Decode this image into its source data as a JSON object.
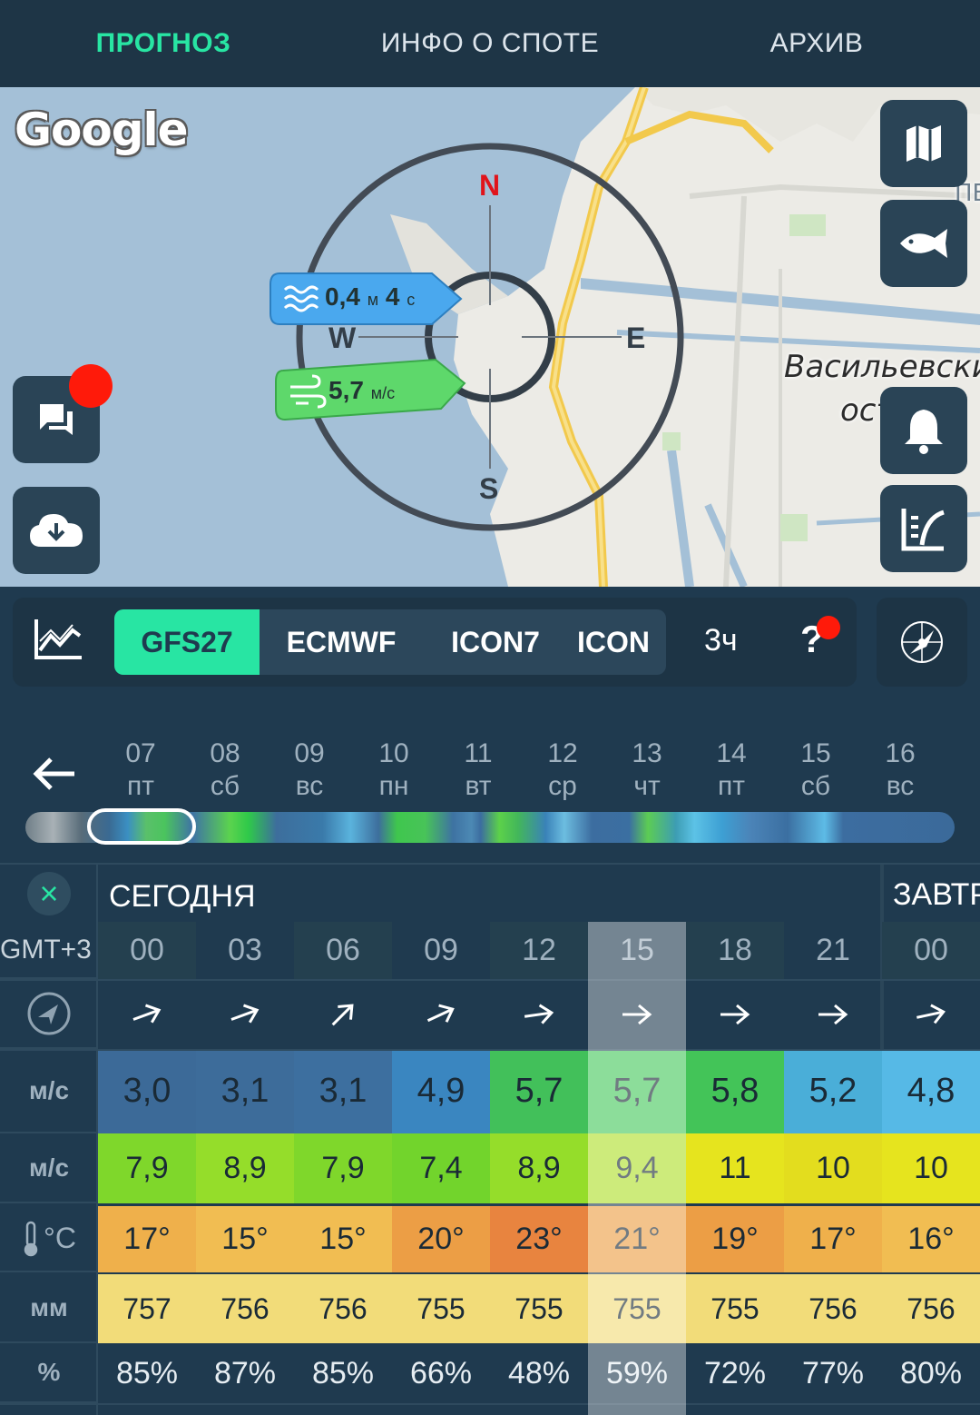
{
  "tabs": [
    {
      "label": "ПРОГНОЗ",
      "active": true
    },
    {
      "label": "ИНФО О СПОТЕ",
      "active": false
    },
    {
      "label": "АРХИВ",
      "active": false
    }
  ],
  "map": {
    "logo": "Google",
    "place_label_1": "Васильевски",
    "place_label_2": "остров",
    "edge_label": "ПЕ",
    "compass": {
      "n": "N",
      "e": "E",
      "s": "S",
      "w": "W"
    },
    "wave": {
      "height": "0,4",
      "height_unit": "м",
      "period": "4",
      "period_unit": "с"
    },
    "wind": {
      "speed": "5,7",
      "unit": "м/с"
    },
    "buttons": [
      "map-icon",
      "fish-icon",
      "bell-icon",
      "tide-icon",
      "chat-icon",
      "cloud-download-icon"
    ]
  },
  "models": {
    "items": [
      "GFS27",
      "ECMWF",
      "ICON7",
      "ICON"
    ],
    "active": "GFS27",
    "step": "3ч",
    "help": "?"
  },
  "days": [
    {
      "num": "07",
      "dow": "пт"
    },
    {
      "num": "08",
      "dow": "сб"
    },
    {
      "num": "09",
      "dow": "вс"
    },
    {
      "num": "10",
      "dow": "пн"
    },
    {
      "num": "11",
      "dow": "вт"
    },
    {
      "num": "12",
      "dow": "ср"
    },
    {
      "num": "13",
      "dow": "чт"
    },
    {
      "num": "14",
      "dow": "пт"
    },
    {
      "num": "15",
      "dow": "сб"
    },
    {
      "num": "16",
      "dow": "вс"
    }
  ],
  "table": {
    "today_label": "СЕГОДНЯ",
    "tomorrow_label": "ЗАВТР",
    "timezone": "GMT+3",
    "row_labels": {
      "wind": "м/с",
      "gust": "м/с",
      "temp": "°C",
      "pressure": "мм",
      "humidity": "%"
    },
    "hours": [
      "00",
      "03",
      "06",
      "09",
      "12",
      "15",
      "18",
      "21",
      "00"
    ],
    "wind": [
      "3,0",
      "3,1",
      "3,1",
      "4,9",
      "5,7",
      "5,7",
      "5,8",
      "5,2",
      "4,8"
    ],
    "gust": [
      "7,9",
      "8,9",
      "7,9",
      "7,4",
      "8,9",
      "9,4",
      "11",
      "10",
      "10"
    ],
    "temp": [
      "17°",
      "15°",
      "15°",
      "20°",
      "23°",
      "21°",
      "19°",
      "17°",
      "16°"
    ],
    "pressure": [
      "757",
      "756",
      "756",
      "755",
      "755",
      "755",
      "755",
      "756",
      "756"
    ],
    "humidity": [
      "85%",
      "87%",
      "85%",
      "66%",
      "48%",
      "59%",
      "72%",
      "77%",
      "80%"
    ],
    "highlight_index": 5
  },
  "colors": {
    "accent": "#28e5a3",
    "dark": "#1f3a4f",
    "panel": "#2a4456",
    "alert": "#ff1a0a"
  }
}
